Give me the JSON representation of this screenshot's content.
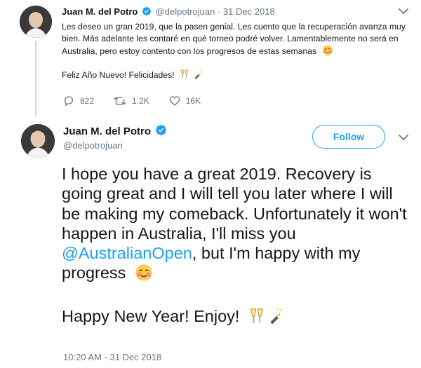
{
  "top_tweet": {
    "author_name": "Juan M. del Potro",
    "handle": "@delpotrojuan",
    "separator": "·",
    "date": "31 Dec 2018",
    "text_line1": "Les deseo un gran 2019, que la pasen genial. Les cuento que la recuperación avanza muy bien. Más adelante les contaré en qué torneo podré volver. Lamentablemente no será en Australia, pero estoy contento con los progresos de estas semanas",
    "text_line2": "Feliz Año Nuevo! Felicidades!",
    "reply_count": "822",
    "retweet_count": "1.2K",
    "like_count": "16K"
  },
  "main_tweet": {
    "author_name": "Juan M. del Potro",
    "handle": "@delpotrojuan",
    "follow_label": "Follow",
    "text_part1": "I hope you have a great 2019. Recovery is going great and I will tell you later where I will be making my comeback. Unfortunately it won't happen in Australia, I'll miss you",
    "mention": "@AustralianOpen",
    "text_part2": ", but I'm happy with my progress",
    "text_part3": "Happy New Year! Enjoy!",
    "timestamp": "10:20 AM - 31 Dec 2018"
  },
  "icons": {
    "verified": "verified-badge-icon",
    "chevron": "chevron-down-icon",
    "reply": "reply-icon",
    "retweet": "retweet-icon",
    "like": "heart-icon",
    "blush": "smiling-face-emoji",
    "cheers": "clinking-glasses-emoji",
    "bottle": "champagne-bottle-emoji"
  },
  "colors": {
    "brand_blue": "#1da1f2",
    "text": "#14171a",
    "secondary": "#657786"
  }
}
